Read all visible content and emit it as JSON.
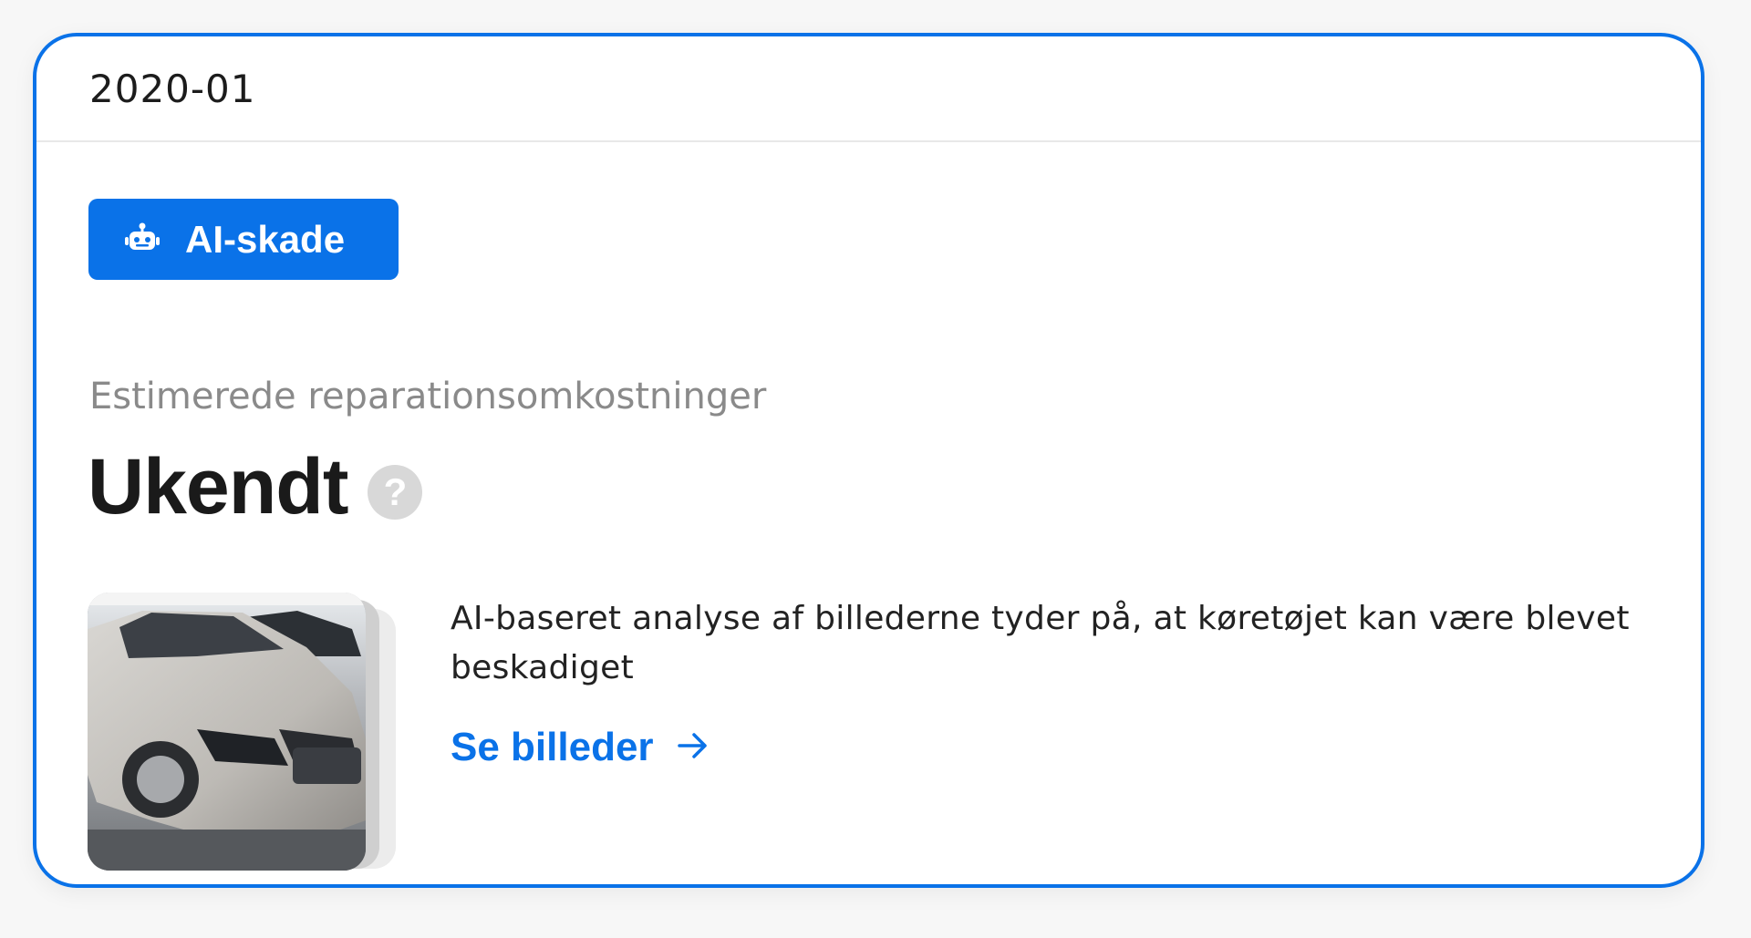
{
  "card": {
    "period": "2020-01",
    "badge": {
      "icon": "robot-icon",
      "label": "AI-skade",
      "color": "#0a72e8"
    },
    "subtitle": "Estimerede reparationsomkostninger",
    "value": "Ukendt",
    "help_icon": "question-circle-icon",
    "help_glyph": "?",
    "thumbnail": {
      "description": "car-photo"
    },
    "description": "AI-baseret analyse af billederne tyder på, at køretøjet kan være blevet beskadiget",
    "link": {
      "label": "Se billeder",
      "icon": "arrow-right-icon"
    }
  },
  "colors": {
    "accent": "#0a72e8",
    "muted_text": "#8a8a8a",
    "divider": "#e8e8e8"
  }
}
